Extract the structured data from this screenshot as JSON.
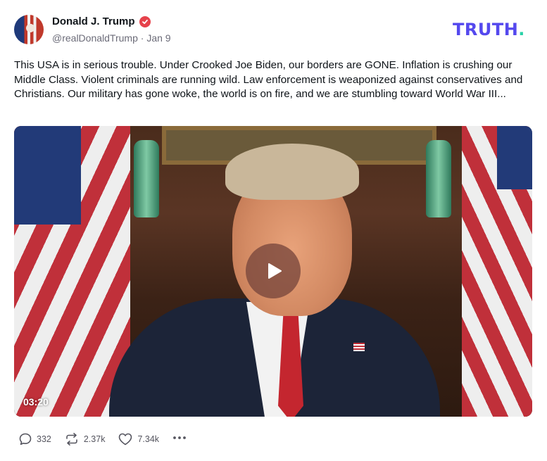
{
  "author": {
    "name": "Donald J. Trump",
    "handle": "@realDonaldTrump",
    "separator": "·",
    "date": "Jan 9"
  },
  "brand": {
    "logo_text": "TRUTH",
    "logo_dot": ".",
    "logo_color": "#5448ee",
    "dot_color": "#29d2a8"
  },
  "post": {
    "text": "This USA is in serious trouble. Under Crooked Joe Biden, our borders are GONE. Inflation is crushing our Middle Class. Violent criminals are running wild. Law enforcement is weaponized against conservatives and Christians. Our military has gone woke, the world is on fire, and we are stumbling toward World War III..."
  },
  "video": {
    "duration": "03:20"
  },
  "actions": {
    "replies": "332",
    "retruths": "2.37k",
    "likes": "7.34k"
  },
  "icons": {
    "verified": "verified-badge-icon",
    "play": "play-icon",
    "reply": "comment-icon",
    "retruth": "repost-icon",
    "like": "heart-icon",
    "more": "more-options-icon"
  }
}
